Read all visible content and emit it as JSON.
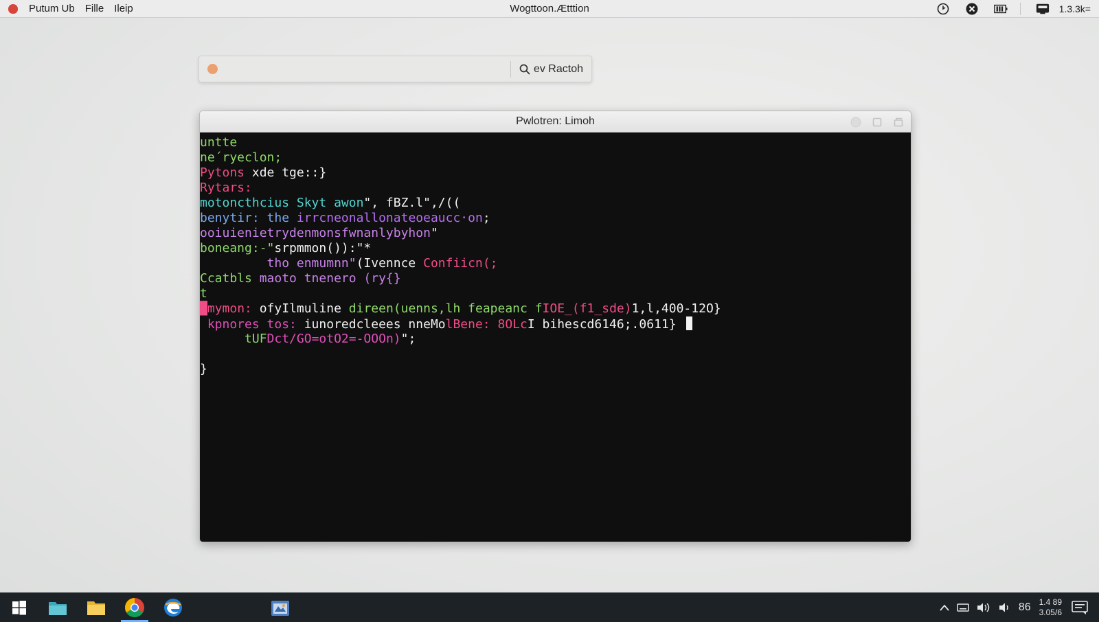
{
  "menubar": {
    "items": [
      "Putum Ub",
      "Fille",
      "Ileip"
    ],
    "title": "Wogttoon.Ætttion",
    "status": "1.3.3k="
  },
  "search": {
    "placeholder": "",
    "button_label": "ev Ractoh",
    "dot_color": "#ec9f6f"
  },
  "window": {
    "title": "Pwlotren: Limoh"
  },
  "terminal": {
    "lines": [
      [
        {
          "t": "untte",
          "c": "green"
        }
      ],
      [
        {
          "t": "ne´ryeclon;",
          "c": "green"
        }
      ],
      [
        {
          "t": "Pytons ",
          "c": "pink"
        },
        {
          "t": "xde tge::}",
          "c": "white"
        }
      ],
      [
        {
          "t": "Rytars:",
          "c": "pink"
        }
      ],
      [
        {
          "t": "motoncthcius Skyt awon",
          "c": "cyan"
        },
        {
          "t": "\", fBZ.l\",/((",
          "c": "white"
        }
      ],
      [
        {
          "t": "benytir: the ",
          "c": "blue"
        },
        {
          "t": "irrcneonallonateoeaucc·on",
          "c": "purple"
        },
        {
          "t": ";",
          "c": "white"
        }
      ],
      [
        {
          "t": "ooiuienietrydenmonsfwnanlybyhon",
          "c": "violet"
        },
        {
          "t": "\"",
          "c": "white"
        }
      ],
      [
        {
          "t": "boneang:-\"",
          "c": "green"
        },
        {
          "t": "srpmmon()):\"*",
          "c": "white"
        }
      ],
      [
        {
          "t": "         tho enmumnn\"",
          "c": "violet"
        },
        {
          "t": "(Ivennce ",
          "c": "white"
        },
        {
          "t": "Confiicn(;",
          "c": "pink"
        }
      ],
      [
        {
          "t": "Ccatbls ",
          "c": "green"
        },
        {
          "t": "maoto tnenero (ry{}",
          "c": "violet"
        }
      ],
      [
        {
          "t": "t",
          "c": "green"
        }
      ],
      [
        {
          "t": "█",
          "c": "pink"
        },
        {
          "t": "mymon: ",
          "c": "pink"
        },
        {
          "t": "of",
          "c": "white"
        },
        {
          "t": "yIlmuline ",
          "c": "white"
        },
        {
          "t": "direen(uenns,lh feapeanc f",
          "c": "green"
        },
        {
          "t": "IOE_(f1_sde)",
          "c": "pink"
        },
        {
          "t": "1,l,400-12O}",
          "c": "white"
        }
      ],
      [
        {
          "t": " kpnores tos: ",
          "c": "magenta"
        },
        {
          "t": "iunoredcleees nneMo",
          "c": "white"
        },
        {
          "t": "lBene: 8OLc",
          "c": "pink"
        },
        {
          "t": "I bihescd6146;.0611} ",
          "c": "white"
        }
      ],
      [
        {
          "t": "      tUF",
          "c": "green"
        },
        {
          "t": "Dct/GO=otO2=-OOOn)",
          "c": "magenta"
        },
        {
          "t": "\";",
          "c": "white"
        }
      ],
      [
        {
          "t": "",
          "c": "white"
        }
      ],
      [
        {
          "t": "}",
          "c": "white"
        }
      ]
    ],
    "cursor_line": 12
  },
  "taskbar": {
    "apps": [
      "windows-start",
      "files",
      "folder",
      "chrome",
      "edge",
      "store"
    ],
    "tray_number": "86",
    "clock_time": "1.4 89",
    "clock_date": "3.05/6"
  }
}
